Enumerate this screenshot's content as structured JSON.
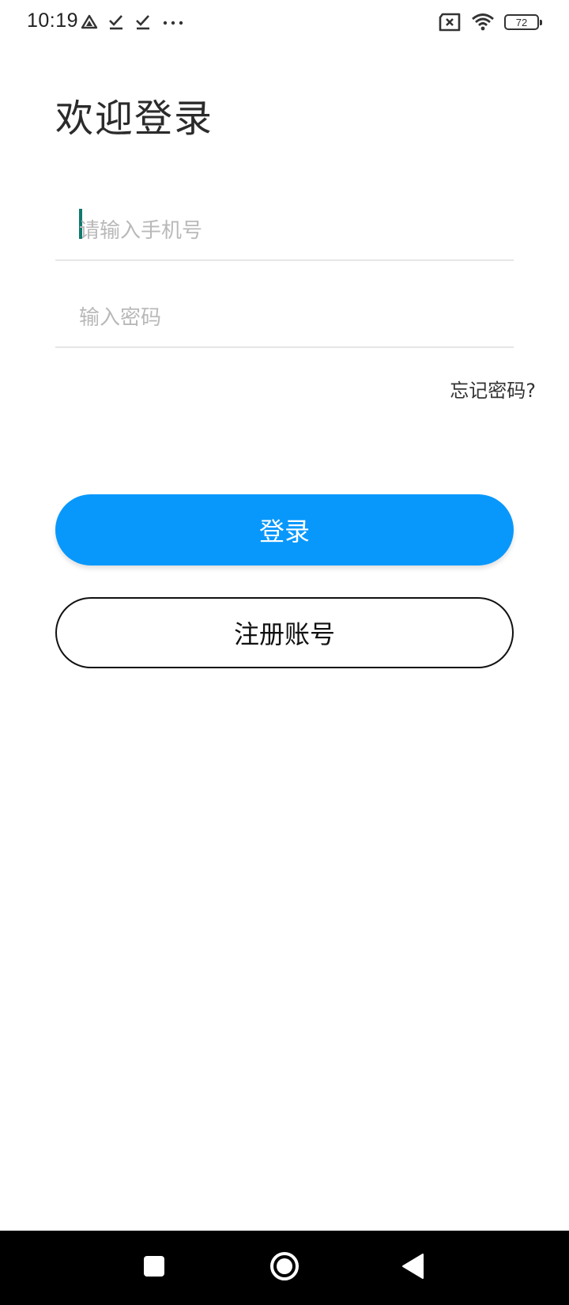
{
  "status_bar": {
    "time": "10:19",
    "battery": "72",
    "left_icons": [
      "drive-icon",
      "check-icon",
      "check-icon",
      "more-dots-icon"
    ],
    "right_icons": [
      "sim-x-icon",
      "wifi-icon",
      "battery-icon"
    ]
  },
  "login": {
    "title": "欢迎登录",
    "phone_placeholder": "请输入手机号",
    "phone_value": "",
    "password_placeholder": "输入密码",
    "password_value": "",
    "forgot_password": "忘记密码?",
    "login_button": "登录",
    "register_button": "注册账号"
  },
  "colors": {
    "primary": "#0898fc",
    "background": "#ffffff",
    "nav_bar": "#000000"
  },
  "nav_bar": {
    "buttons": [
      "recent-apps-icon",
      "home-icon",
      "back-icon"
    ]
  }
}
